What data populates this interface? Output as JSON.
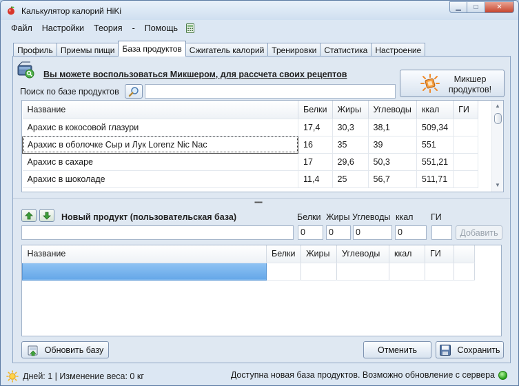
{
  "window": {
    "title": "Калькулятор калорий HiKi",
    "minimize": "▁",
    "maximize": "□",
    "close": "✕"
  },
  "menu": {
    "file": "Файл",
    "settings": "Настройки",
    "theory": "Теория",
    "separator": "-",
    "help": "Помощь"
  },
  "tabs": [
    "Профиль",
    "Приемы пищи",
    "База продуктов",
    "Сжигатель калорий",
    "Тренировки",
    "Статистика",
    "Настроение"
  ],
  "active_tab": "База продуктов",
  "db": {
    "mixer_hint": "Вы можете воспользоваться Микшером, для рассчета своих рецептов",
    "search_label": "Поиск по базе продуктов",
    "search_value": "",
    "mixer_button_line1": "Микшер",
    "mixer_button_line2": "продуктов!"
  },
  "products_table": {
    "columns": [
      "Название",
      "Белки",
      "Жиры",
      "Углеводы",
      "ккал",
      "ГИ"
    ],
    "rows": [
      [
        "Арахис в кокосовой глазури",
        "17,4",
        "30,3",
        "38,1",
        "509,34",
        ""
      ],
      [
        "Арахис в оболочке Сыр и Лук Lorenz Nic Nac",
        "16",
        "35",
        "39",
        "551",
        ""
      ],
      [
        "Арахис в сахаре",
        "17",
        "29,6",
        "50,3",
        "551,21",
        ""
      ],
      [
        "Арахис в шоколаде",
        "11,4",
        "25",
        "56,7",
        "511,71",
        ""
      ]
    ]
  },
  "new_product": {
    "title": "Новый продукт (пользовательская база)",
    "labels": {
      "protein": "Белки",
      "fat": "Жиры",
      "carbs": "Углеводы",
      "kcal": "ккал",
      "gi": "ГИ"
    },
    "name_value": "",
    "protein_value": "0",
    "fat_value": "0",
    "carbs_value": "0",
    "kcal_value": "0",
    "gi_value": "",
    "add_button": "Добавить"
  },
  "user_table": {
    "columns": [
      "Название",
      "Белки",
      "Жиры",
      "Углеводы",
      "ккал",
      "ГИ"
    ]
  },
  "buttons": {
    "update_db": "Обновить базу",
    "cancel": "Отменить",
    "save": "Сохранить"
  },
  "status": {
    "left": "Дней: 1 | Изменение веса: 0 кг",
    "right": "Доступна новая база продуктов. Возможно обновление с сервера"
  },
  "colors": {
    "accent_blue": "#65a7e8",
    "status_green": "#25a018",
    "window_bg": "#dce7f3"
  }
}
